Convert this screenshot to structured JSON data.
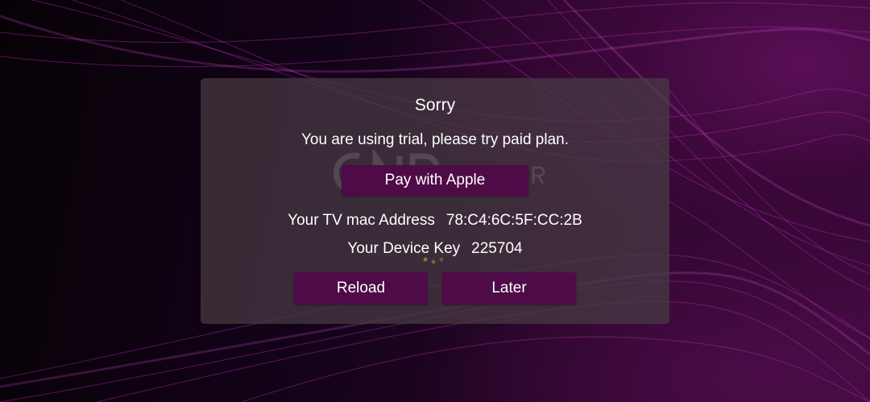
{
  "dialog": {
    "title": "Sorry",
    "message": "You are using trial, please try paid plan.",
    "pay_button_label": "Pay with Apple",
    "mac_label": "Your TV mac Address",
    "mac_value": "78:C4:6C:5F:CC:2B",
    "device_key_label": "Your Device Key",
    "device_key_value": "225704",
    "reload_button_label": "Reload",
    "later_button_label": "Later"
  },
  "colors": {
    "background_accent": "#5a0f57",
    "button": "#4e0b47",
    "dialog_panel": "#483c44",
    "text": "#ffffff"
  },
  "icons": {
    "background_logo": "app-logo-icon",
    "loading": "loading-spinner-icon"
  }
}
